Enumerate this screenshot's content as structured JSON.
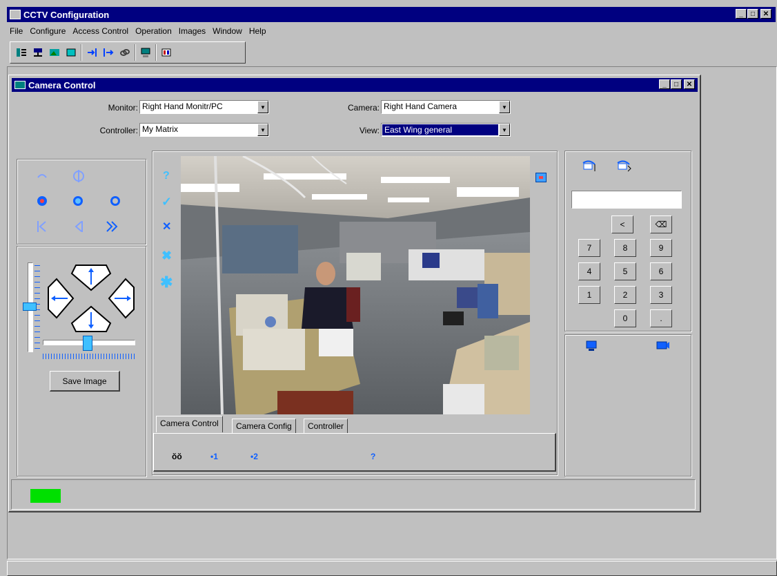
{
  "app": {
    "title": "CCTV Configuration"
  },
  "menu": [
    "File",
    "Configure",
    "Access Control",
    "Operation",
    "Images",
    "Window",
    "Help"
  ],
  "child_window": {
    "title": "Camera Control"
  },
  "form": {
    "monitor_label": "Monitor:",
    "monitor_value": "Right Hand Monitr/PC",
    "controller_label": "Controller:",
    "controller_value": "My Matrix",
    "camera_label": "Camera:",
    "camera_value": "Right Hand Camera",
    "view_label": "View:",
    "view_value": "East Wing general"
  },
  "save_image_label": "Save Image",
  "video_icons": [
    "?",
    "✓",
    "✕",
    "✖",
    "✱"
  ],
  "tabs": [
    "Camera Control",
    "Camera Config",
    "Controller"
  ],
  "tab_content": {
    "item1": "ŏŏ",
    "item2": "•1",
    "item3": "•2",
    "help": "?"
  },
  "keypad": {
    "display_value": "",
    "row0": [
      "<",
      "⌫"
    ],
    "row1": [
      "7",
      "8",
      "9"
    ],
    "row2": [
      "4",
      "5",
      "6"
    ],
    "row3": [
      "1",
      "2",
      "3"
    ],
    "row4": [
      "0",
      "."
    ]
  },
  "colors": {
    "titlebar": "#000080",
    "face": "#c0c0c0",
    "status_led": "#00e000",
    "icon_blue": "#1060ff"
  }
}
